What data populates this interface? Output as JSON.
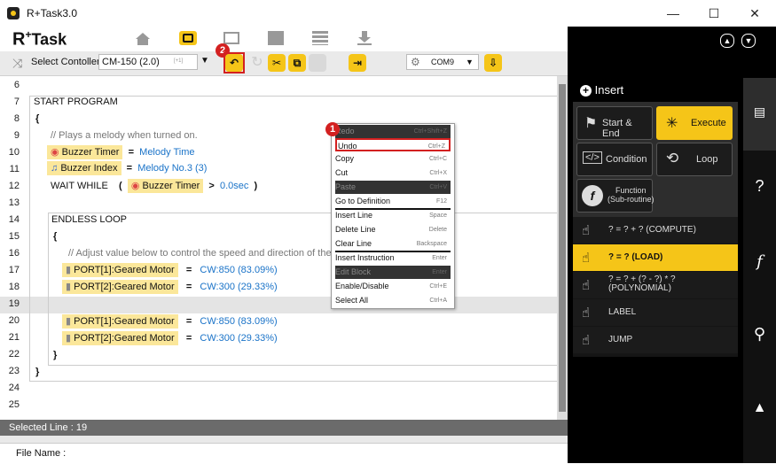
{
  "window": {
    "title": "R+Task3.0",
    "minimize": "—",
    "maximize": "☐",
    "close": "✕"
  },
  "brand": {
    "logo_r": "R",
    "logo_plus": "+",
    "logo_task": "Task"
  },
  "toolbar": {
    "controller_label": "Select Contoller",
    "controller_value": "CM-150 (2.0)",
    "controller_key": "[+1]",
    "port_value": "COM9",
    "callouts": {
      "undo_badge": "2",
      "menu_badge": "1"
    }
  },
  "editor": {
    "lines": [
      {
        "n": "6"
      },
      {
        "n": "7"
      },
      {
        "n": "8"
      },
      {
        "n": "9"
      },
      {
        "n": "10"
      },
      {
        "n": "11"
      },
      {
        "n": "12"
      },
      {
        "n": "13"
      },
      {
        "n": "14"
      },
      {
        "n": "15"
      },
      {
        "n": "16"
      },
      {
        "n": "17"
      },
      {
        "n": "18"
      },
      {
        "n": "19"
      },
      {
        "n": "20"
      },
      {
        "n": "21"
      },
      {
        "n": "22"
      },
      {
        "n": "23"
      },
      {
        "n": "24"
      },
      {
        "n": "25"
      }
    ],
    "start_program": "START PROGRAM",
    "open_brace": "{",
    "close_brace": "}",
    "comment1": "//   Plays a melody when turned on.",
    "buzzer_timer": "Buzzer Timer",
    "eq": "=",
    "melody_time": "Melody Time",
    "buzzer_index": "Buzzer Index",
    "melody_no": "Melody No.3 (3)",
    "wait_while": "WAIT WHILE",
    "paren_open": "(",
    "paren_close": ")",
    "gt": ">",
    "zero_sec": "0.0sec",
    "endless_loop": "ENDLESS LOOP",
    "comment2": "//   Adjust value below to control the speed and direction of the r",
    "port1": "PORT[1]:Geared Motor",
    "port2": "PORT[2]:Geared Motor",
    "cw850": "CW:850 (83.09%)",
    "cw300": "CW:300 (29.33%)"
  },
  "status": {
    "selected_line": "Selected Line : 19",
    "file_name": "File Name :"
  },
  "context_menu": {
    "items": [
      {
        "label": "Redo",
        "key": "Ctrl+Shift+Z",
        "disabled": true
      },
      {
        "label": "Undo",
        "key": "Ctrl+Z"
      },
      {
        "label": "Copy",
        "key": "Ctrl+C"
      },
      {
        "label": "Cut",
        "key": "Ctrl+X"
      },
      {
        "label": "Paste",
        "key": "Ctrl+V",
        "disabled": true
      },
      {
        "label": "Go to Definition",
        "key": "F12"
      },
      {
        "label": "Insert Line",
        "key": "Space"
      },
      {
        "label": "Delete Line",
        "key": "Delete"
      },
      {
        "label": "Clear Line",
        "key": "Backspace"
      },
      {
        "label": "Insert Instruction",
        "key": "Enter"
      },
      {
        "label": "Edit Block",
        "key": "Enter",
        "disabled": true
      },
      {
        "label": "Enable/Disable",
        "key": "Ctrl+E"
      },
      {
        "label": "Select All",
        "key": "Ctrl+A"
      }
    ]
  },
  "insert_panel": {
    "title": "Insert",
    "buttons": [
      {
        "label": "Start & End"
      },
      {
        "label": "Execute"
      },
      {
        "label": "Condition"
      },
      {
        "label": "Loop"
      },
      {
        "label": "Function\n(Sub-routine)"
      }
    ],
    "list": [
      {
        "label": "? = ? + ?  (COMPUTE)"
      },
      {
        "label": "? = ?  (LOAD)"
      },
      {
        "label": "? = ? + (? - ?) * ?\n(POLYNOMIAL)"
      },
      {
        "label": "LABEL"
      },
      {
        "label": "JUMP"
      }
    ]
  },
  "colors": {
    "accent": "#f5c518",
    "highlight": "#d32020",
    "value_text": "#1a73c8"
  }
}
